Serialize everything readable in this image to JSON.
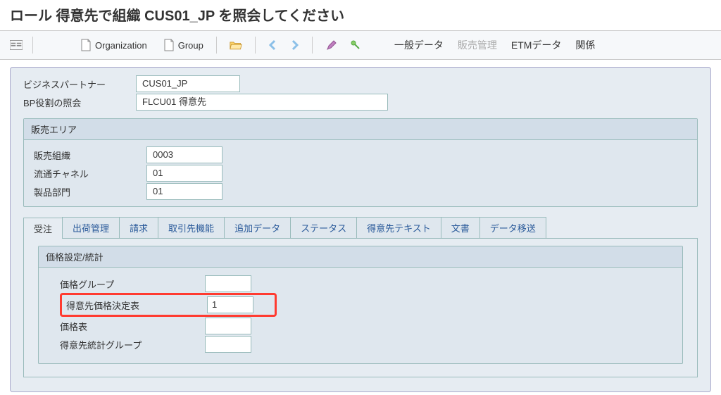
{
  "title": "ロール 得意先で組織 CUS01_JP を照会してください",
  "toolbar": {
    "organization": "Organization",
    "group": "Group",
    "general_data": "一般データ",
    "sales_mgmt": "販売管理",
    "etm_data": "ETMデータ",
    "relations": "関係"
  },
  "header": {
    "bp_label": "ビジネスパートナー",
    "bp_value": "CUS01_JP",
    "role_label": "BP役割の照会",
    "role_value": "FLCU01 得意先"
  },
  "sales_area": {
    "title": "販売エリア",
    "org_label": "販売組織",
    "org_value": "0003",
    "channel_label": "流通チャネル",
    "channel_value": "01",
    "division_label": "製品部門",
    "division_value": "01"
  },
  "tabs": {
    "order": "受注",
    "shipping": "出荷管理",
    "billing": "請求",
    "partner": "取引先機能",
    "add_data": "追加データ",
    "status": "ステータス",
    "cust_text": "得意先テキスト",
    "docs": "文書",
    "data_transfer": "データ移送"
  },
  "pricing": {
    "title": "価格設定/統計",
    "price_group_label": "価格グループ",
    "price_group_value": "",
    "cust_pricing_label": "得意先価格決定表",
    "cust_pricing_value": "1",
    "price_list_label": "価格表",
    "price_list_value": "",
    "stats_group_label": "得意先統計グループ",
    "stats_group_value": ""
  }
}
